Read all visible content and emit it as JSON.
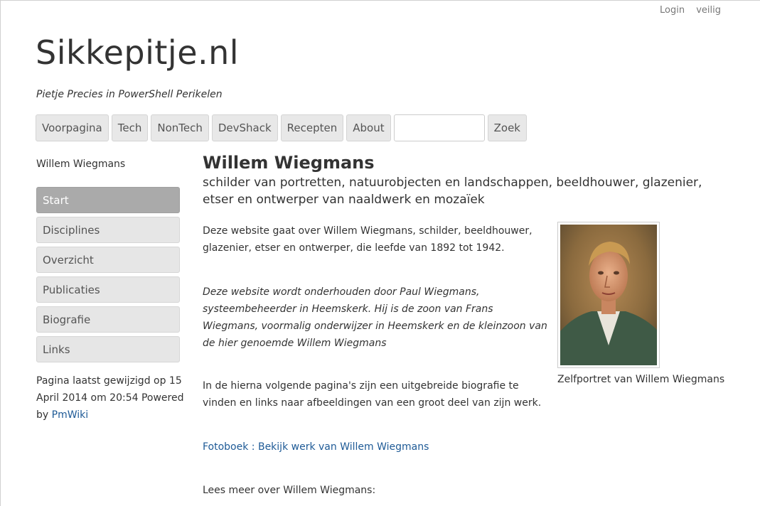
{
  "user_links": {
    "login": "Login",
    "secure": "veilig"
  },
  "site": {
    "title": "Sikkepitje.nl",
    "tagline": "Pietje Precies in PowerShell Perikelen"
  },
  "nav": {
    "items": [
      "Voorpagina",
      "Tech",
      "NonTech",
      "DevShack",
      "Recepten",
      "About"
    ],
    "search_value": "",
    "search_button": "Zoek"
  },
  "sidebar": {
    "page_name": "Willem Wiegmans",
    "items": [
      {
        "label": "Start",
        "active": true
      },
      {
        "label": "Disciplines",
        "active": false
      },
      {
        "label": "Overzicht",
        "active": false
      },
      {
        "label": "Publicaties",
        "active": false
      },
      {
        "label": "Biografie",
        "active": false
      },
      {
        "label": "Links",
        "active": false
      }
    ],
    "footer_text": "Pagina laatst gewijzigd op 15 April 2014 om 20:54 Powered by",
    "footer_link": "PmWiki"
  },
  "main": {
    "title": "Willem Wiegmans",
    "subtitle": "schilder van portretten, natuurobjecten en landschappen, beeldhouwer, glazenier, etser en ontwerper van naaldwerk en mozaïek",
    "para1": "Deze website gaat over Willem Wiegmans, schilder, beeldhouwer, glazenier, etser en ontwerper, die leefde van 1892 tot 1942.",
    "para2": "Deze website wordt onderhouden door Paul Wiegmans, systeembeheerder in Heemskerk. Hij is de zoon van Frans Wiegmans, voormalig onderwijzer in Heemskerk en de kleinzoon van de hier genoemde Willem Wiegmans",
    "para3": "In de hierna volgende pagina's zijn een uitgebreide biografie te vinden en links naar afbeeldingen van een groot deel van zijn werk.",
    "fotoboek_link": "Fotoboek : Bekijk werk van Willem Wiegmans",
    "para5": "Lees meer over Willem Wiegmans:",
    "figure_caption": "Zelfportret van Willem Wiegmans"
  }
}
